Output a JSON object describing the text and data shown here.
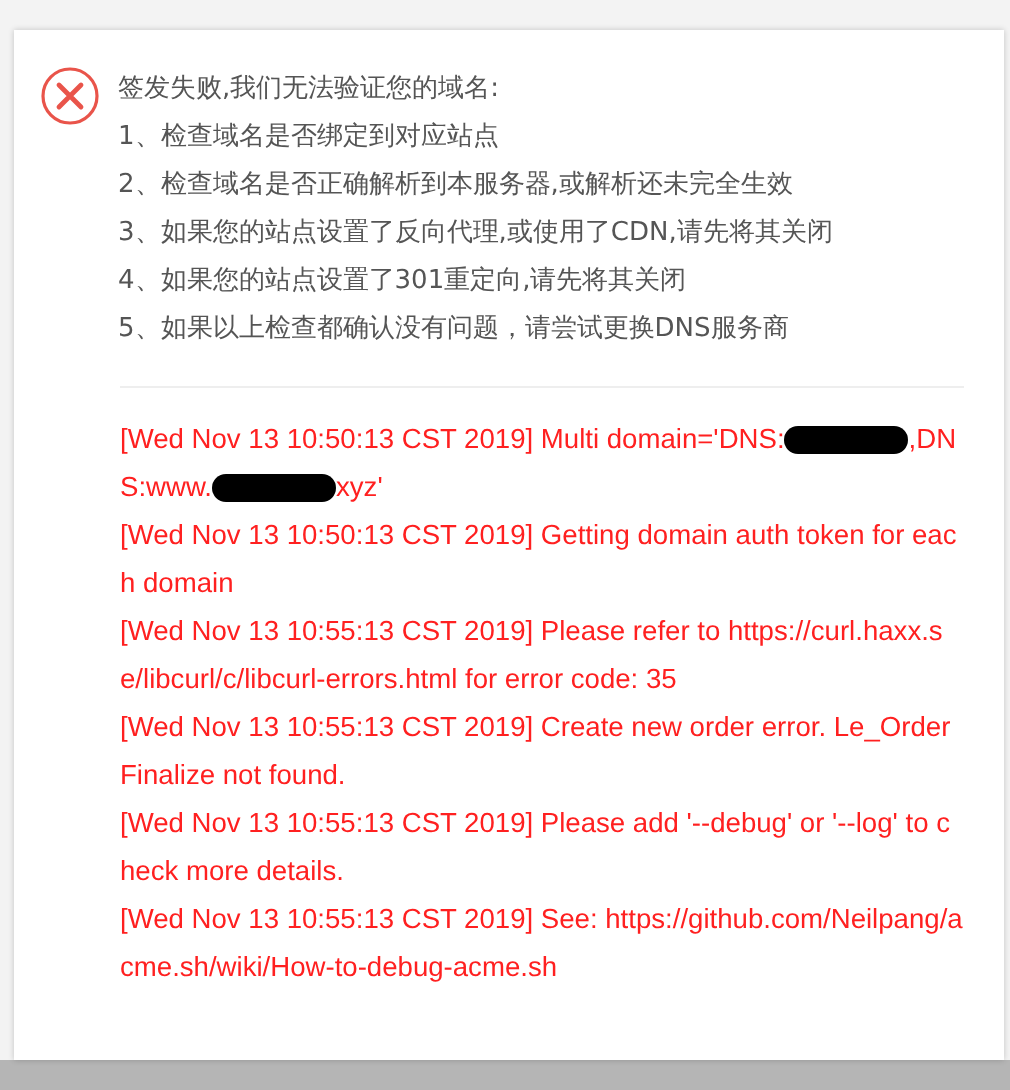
{
  "dialog": {
    "title": "签发失败,我们无法验证您的域名:",
    "tips": [
      "1、检查域名是否绑定到对应站点",
      "2、检查域名是否正确解析到本服务器,或解析还未完全生效",
      "3、如果您的站点设置了反向代理,或使用了CDN,请先将其关闭",
      "4、如果您的站点设置了301重定向,请先将其关闭",
      "5、如果以上检查都确认没有问题，请尝试更换DNS服务商"
    ],
    "log": [
      {
        "kind": "redacted",
        "parts": [
          "[Wed Nov 13 10:50:13 CST 2019] Multi domain='DNS:",
          ",DNS:www.",
          "xyz'"
        ]
      },
      {
        "kind": "plain",
        "text": "[Wed Nov 13 10:50:13 CST 2019] Getting domain auth token for each domain"
      },
      {
        "kind": "plain",
        "text": "[Wed Nov 13 10:55:13 CST 2019] Please refer to https://curl.haxx.se/libcurl/c/libcurl-errors.html for error code: 35"
      },
      {
        "kind": "plain",
        "text": "[Wed Nov 13 10:55:13 CST 2019] Create new order error. Le_OrderFinalize not found."
      },
      {
        "kind": "plain",
        "text": "[Wed Nov 13 10:55:13 CST 2019] Please add '--debug' or '--log' to check more details."
      },
      {
        "kind": "plain",
        "text": "[Wed Nov 13 10:55:13 CST 2019] See: https://github.com/Neilpang/acme.sh/wiki/How-to-debug-acme.sh"
      }
    ]
  }
}
